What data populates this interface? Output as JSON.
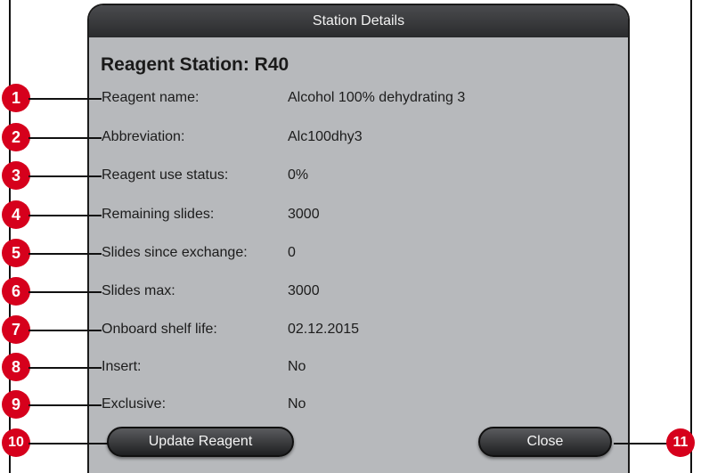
{
  "dialog": {
    "title": "Station Details"
  },
  "heading": "Reagent Station: R40",
  "rows": [
    {
      "marker": "1",
      "label": "Reagent name:",
      "value": "Alcohol 100% dehydrating 3"
    },
    {
      "marker": "2",
      "label": "Abbreviation:",
      "value": "Alc100dhy3"
    },
    {
      "marker": "3",
      "label": "Reagent use status:",
      "value": "0%"
    },
    {
      "marker": "4",
      "label": "Remaining slides:",
      "value": "3000"
    },
    {
      "marker": "5",
      "label": "Slides since exchange:",
      "value": "0"
    },
    {
      "marker": "6",
      "label": "Slides max:",
      "value": "3000"
    },
    {
      "marker": "7",
      "label": "Onboard shelf life:",
      "value": "02.12.2015"
    },
    {
      "marker": "8",
      "label": "Insert:",
      "value": "No"
    },
    {
      "marker": "9",
      "label": "Exclusive:",
      "value": "No"
    }
  ],
  "buttons": {
    "update": {
      "label": "Update Reagent",
      "marker": "10"
    },
    "close": {
      "label": "Close",
      "marker": "11"
    }
  },
  "colors": {
    "marker": "#d6001c",
    "dialog_bg": "#b7b9bc",
    "titlebar": "#2f3032"
  }
}
